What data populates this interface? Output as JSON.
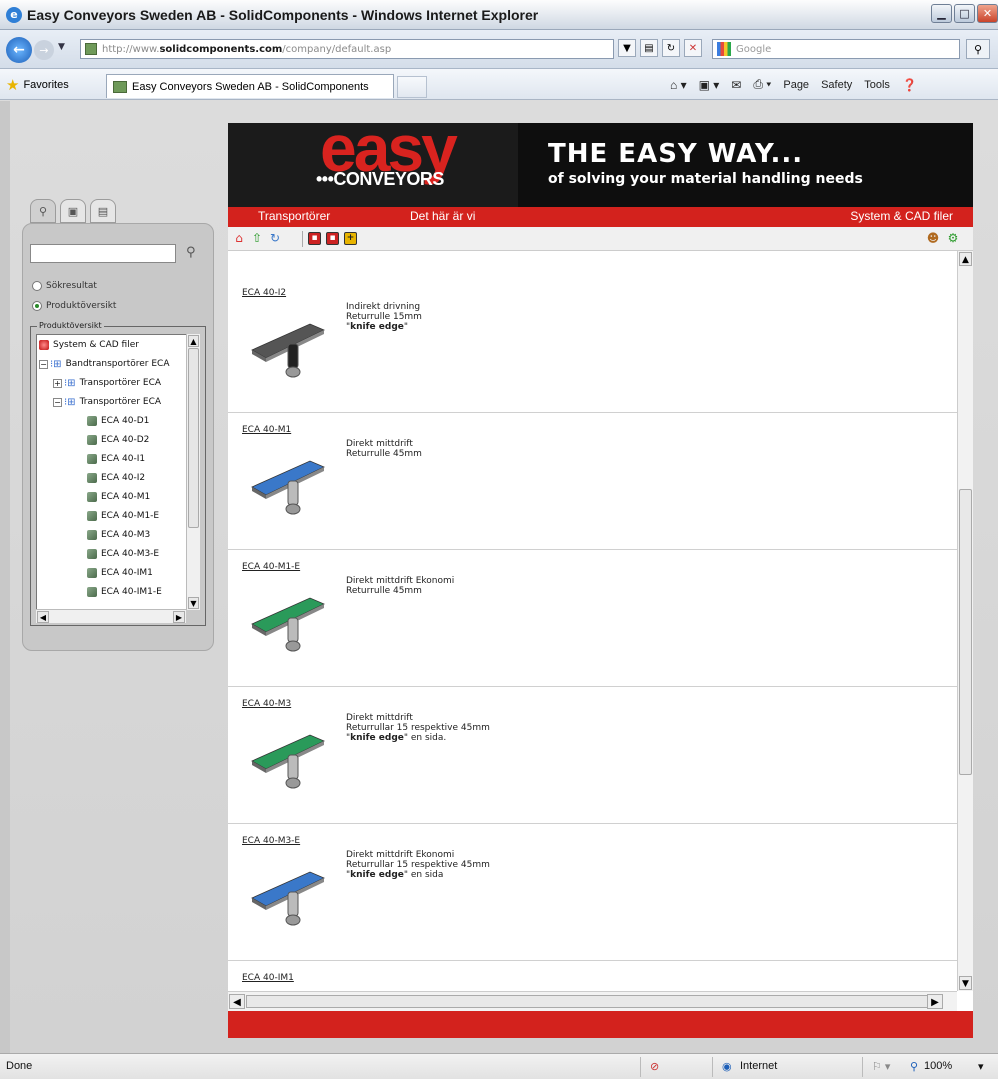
{
  "window": {
    "title": "Easy Conveyors Sweden AB - SolidComponents - Windows Internet Explorer"
  },
  "address": {
    "url_prefix": "http://www.",
    "url_domain": "solidcomponents.com",
    "url_path": "/company/default.asp",
    "search_placeholder": "Google"
  },
  "favorites": {
    "label": "Favorites",
    "tab_title": "Easy Conveyors Sweden AB - SolidComponents"
  },
  "commandbar": {
    "page": "Page",
    "safety": "Safety",
    "tools": "Tools"
  },
  "panel": {
    "radio_results": "Sökresultat",
    "radio_overview": "Produktöversikt",
    "selected": "Produktöversikt",
    "fieldset_legend": "Produktöversikt",
    "tree": [
      {
        "label": "System & CAD filer",
        "icon": "system-icon"
      },
      {
        "label": "Bandtransportörer ECA",
        "icon": "folder-icon"
      },
      {
        "label": "Transportörer ECA",
        "icon": "folder-icon"
      },
      {
        "label": "Transportörer ECA",
        "icon": "folder-icon"
      },
      {
        "label": "ECA 40-D1",
        "icon": "product-icon"
      },
      {
        "label": "ECA 40-D2",
        "icon": "product-icon"
      },
      {
        "label": "ECA 40-I1",
        "icon": "product-icon"
      },
      {
        "label": "ECA 40-I2",
        "icon": "product-icon"
      },
      {
        "label": "ECA 40-M1",
        "icon": "product-icon"
      },
      {
        "label": "ECA 40-M1-E",
        "icon": "product-icon"
      },
      {
        "label": "ECA 40-M3",
        "icon": "product-icon"
      },
      {
        "label": "ECA 40-M3-E",
        "icon": "product-icon"
      },
      {
        "label": "ECA 40-IM1",
        "icon": "product-icon"
      },
      {
        "label": "ECA 40-IM1-E",
        "icon": "product-icon"
      }
    ]
  },
  "site": {
    "logo_main": "easy",
    "logo_sub": "•••CONVEYORS",
    "tagline_1": "THE EASY WAY...",
    "tagline_2": "of solving your material handling needs",
    "menu": [
      "Transportörer",
      "Det här är vi",
      "System & CAD filer"
    ],
    "brand_red": "#d3221d",
    "items": [
      {
        "code": "ECA 40-I2",
        "line1": "Indirekt drivning",
        "line2": "Returrulle 15mm",
        "line3_bold": "knife edge",
        "line3_rest": "",
        "belt_color": "#555555"
      },
      {
        "code": "ECA 40-M1",
        "line1": "Direkt mittdrift",
        "line2": "Returrulle 45mm",
        "line3_bold": "",
        "line3_rest": "",
        "belt_color": "#3a78c9"
      },
      {
        "code": "ECA 40-M1-E",
        "line1": "Direkt mittdrift Ekonomi",
        "line2": "Returrulle 45mm",
        "line3_bold": "",
        "line3_rest": "",
        "belt_color": "#2a9a5a"
      },
      {
        "code": "ECA 40-M3",
        "line1": "Direkt mittdrift",
        "line2": "Returrullar 15 respektive 45mm",
        "line3_bold": "knife edge",
        "line3_rest": " en sida.",
        "belt_color": "#2a9a5a"
      },
      {
        "code": "ECA 40-M3-E",
        "line1": "Direkt mittdrift Ekonomi",
        "line2": "Returrullar 15 respektive 45mm",
        "line3_bold": "knife edge",
        "line3_rest": " en sida",
        "belt_color": "#3a78c9"
      },
      {
        "code": "ECA 40-IM1",
        "line1": "",
        "line2": "",
        "line3_bold": "",
        "line3_rest": "",
        "belt_color": ""
      }
    ]
  },
  "status": {
    "left": "Done",
    "zone": "Internet",
    "zoom": "100%"
  }
}
